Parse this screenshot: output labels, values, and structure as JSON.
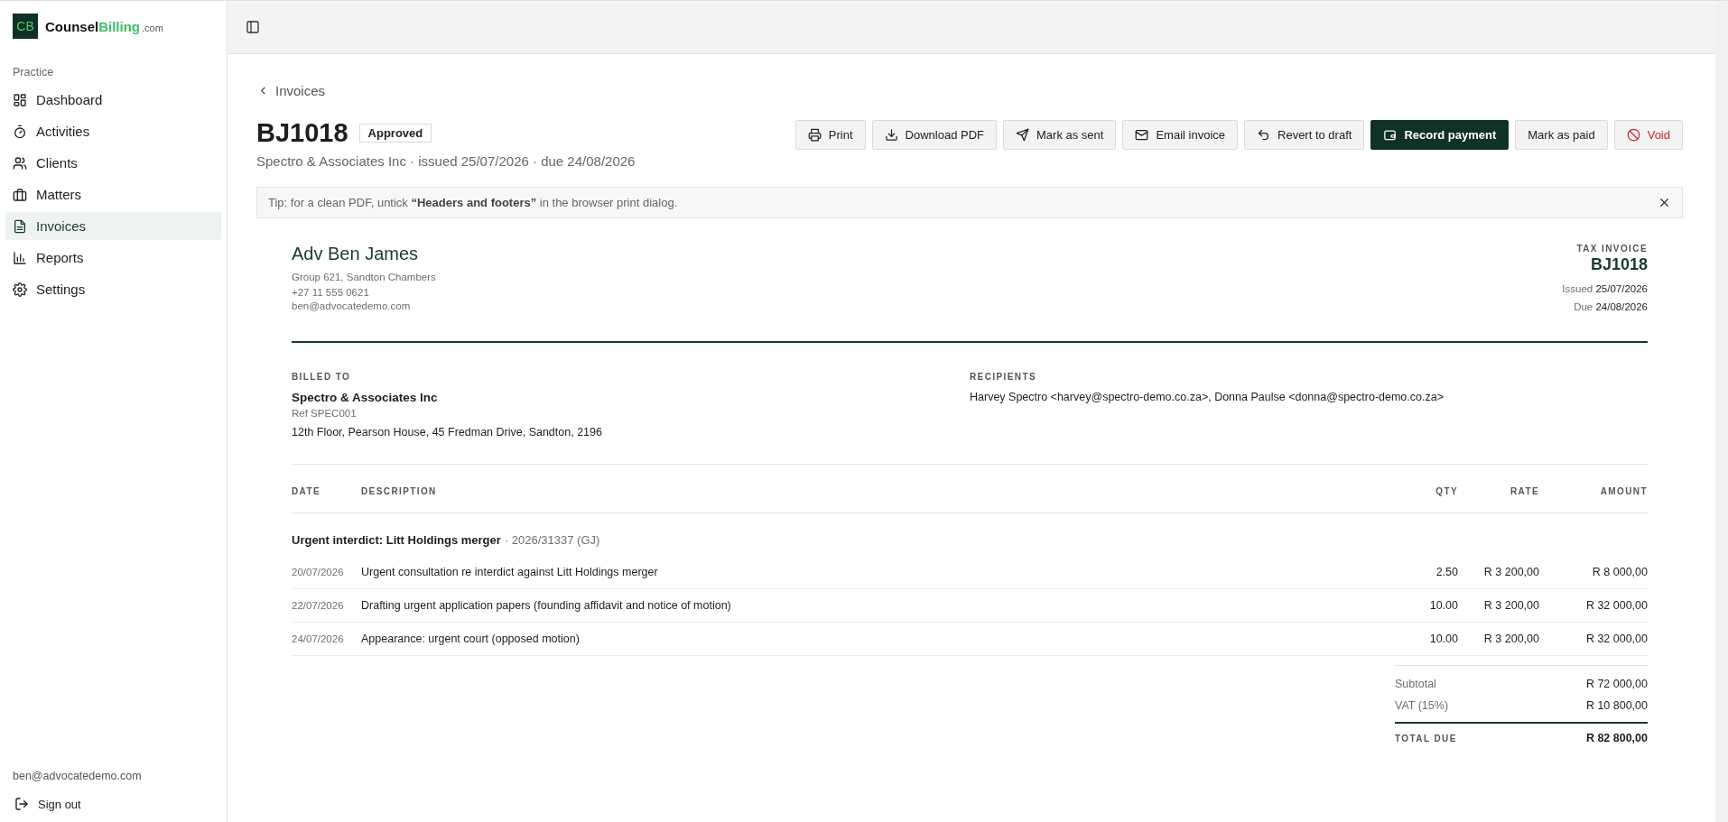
{
  "brand": {
    "mark": "CB",
    "name_main": "Counsel",
    "name_accent": "Billing",
    "domain": ".com"
  },
  "sidebar": {
    "section": "Practice",
    "items": [
      {
        "label": "Dashboard",
        "selected": false
      },
      {
        "label": "Activities",
        "selected": false
      },
      {
        "label": "Clients",
        "selected": false
      },
      {
        "label": "Matters",
        "selected": false
      },
      {
        "label": "Invoices",
        "selected": true
      },
      {
        "label": "Reports",
        "selected": false
      },
      {
        "label": "Settings",
        "selected": false
      }
    ],
    "user_email": "ben@advocatedemo.com",
    "sign_out": "Sign out"
  },
  "breadcrumb": "Invoices",
  "invoice_header": {
    "number": "BJ1018",
    "status": "Approved",
    "subtitle": "Spectro & Associates Inc · issued 25/07/2026 · due 24/08/2026"
  },
  "actions": [
    {
      "label": "Print",
      "kind": "default"
    },
    {
      "label": "Download PDF",
      "kind": "default"
    },
    {
      "label": "Mark as sent",
      "kind": "default"
    },
    {
      "label": "Email invoice",
      "kind": "default"
    },
    {
      "label": "Revert to draft",
      "kind": "default"
    },
    {
      "label": "Record payment",
      "kind": "primary"
    },
    {
      "label": "Mark as paid",
      "kind": "default"
    },
    {
      "label": "Void",
      "kind": "danger"
    }
  ],
  "tip": "Tip: for a clean PDF, untick **“Headers and footers”** in the browser print dialog.",
  "document": {
    "from": {
      "name": "Adv Ben James",
      "address": "Group 621, Sandton Chambers",
      "phone": "+27 11 555 0621",
      "email": "ben@advocatedemo.com"
    },
    "doc_type": "TAX INVOICE",
    "number": "BJ1018",
    "issued_label": "Issued",
    "issued": "25/07/2026",
    "due_label": "Due",
    "due": "24/08/2026",
    "billed_to_label": "BILLED TO",
    "client": "Spectro & Associates Inc",
    "ref": "Ref SPEC001",
    "client_address": "12th Floor, Pearson House, 45 Fredman Drive, Sandton, 2196",
    "recipients_label": "RECIPIENTS",
    "recipients": "Harvey Spectro <harvey@spectro-demo.co.za>, Donna Paulse <donna@spectro-demo.co.za>",
    "table": {
      "columns": [
        "DATE",
        "DESCRIPTION",
        "QTY",
        "RATE",
        "AMOUNT"
      ],
      "group": {
        "title": "Urgent interdict: Litt Holdings merger",
        "ref": "· 2026/31337 (GJ)"
      },
      "rows": [
        {
          "date": "20/07/2026",
          "description": "Urgent consultation re interdict against Litt Holdings merger",
          "qty": "2.50",
          "rate": "R 3 200,00",
          "amount": "R 8 000,00"
        },
        {
          "date": "22/07/2026",
          "description": "Drafting urgent application papers (founding affidavit and notice of motion)",
          "qty": "10.00",
          "rate": "R 3 200,00",
          "amount": "R 32 000,00"
        },
        {
          "date": "24/07/2026",
          "description": "Appearance: urgent court (opposed motion)",
          "qty": "10.00",
          "rate": "R 3 200,00",
          "amount": "R 32 000,00"
        }
      ]
    },
    "totals": [
      {
        "label": "Subtotal",
        "value": "R 72 000,00",
        "kind": "line"
      },
      {
        "label": "VAT (15%)",
        "value": "R 10 800,00",
        "kind": "line"
      },
      {
        "label": "TOTAL DUE",
        "value": "R 82 800,00",
        "kind": "total"
      }
    ]
  }
}
